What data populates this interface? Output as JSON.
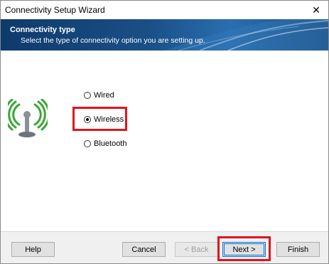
{
  "window": {
    "title": "Connectivity Setup Wizard",
    "close_glyph": "✕"
  },
  "banner": {
    "title": "Connectivity type",
    "subtitle": "Select the type of connectivity option you are setting up."
  },
  "options": [
    {
      "label": "Wired",
      "selected": false
    },
    {
      "label": "Wireless",
      "selected": true
    },
    {
      "label": "Bluetooth",
      "selected": false
    }
  ],
  "buttons": {
    "help": "Help",
    "cancel": "Cancel",
    "back": "< Back",
    "next": "Next >",
    "finish": "Finish"
  },
  "colors": {
    "highlight": "#e0141e",
    "icon_green": "#3aa635",
    "banner_dark": "#0e3a6b"
  },
  "icons": {
    "connectivity": "wireless-antenna-icon"
  }
}
